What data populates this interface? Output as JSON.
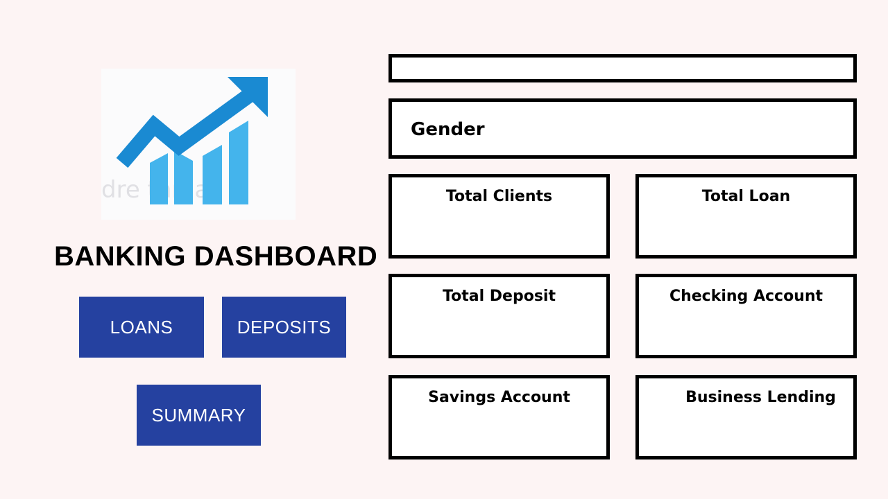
{
  "app": {
    "title": "BANKING DASHBOARD",
    "logo_icon": "growth-chart-icon"
  },
  "nav": {
    "loans": "LOANS",
    "deposits": "DEPOSITS",
    "summary": "SUMMARY"
  },
  "filters": {
    "gender_label": "Gender"
  },
  "cards": {
    "total_clients": "Total Clients",
    "total_loan": "Total Loan",
    "total_deposit": "Total Deposit",
    "checking_account": "Checking Account",
    "savings_account": "Savings Account",
    "business_lending": "Business Lending"
  },
  "colors": {
    "background": "#fdf4f4",
    "nav_button": "#2541a0",
    "nav_text": "#ffffff",
    "logo_arrow": "#1a8ad2",
    "logo_bars": "#44b4ec"
  }
}
